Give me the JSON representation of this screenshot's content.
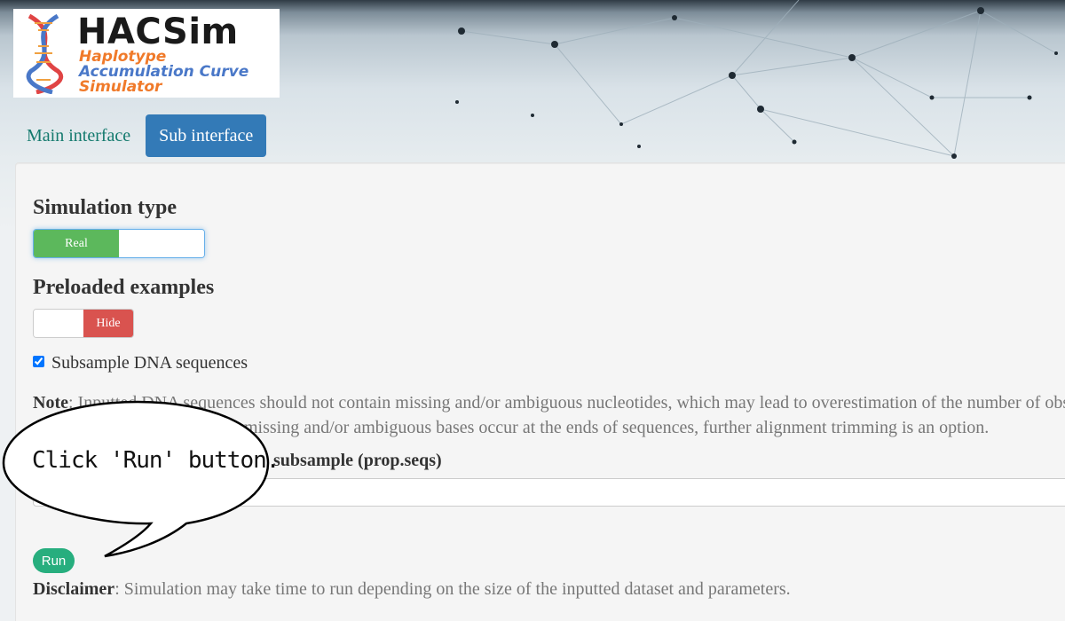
{
  "app": {
    "logo": {
      "title": "HACSim",
      "subtitle_lines": [
        "Haplotype",
        "Accumulation Curve",
        "Simulator"
      ]
    }
  },
  "tabs": [
    {
      "label": "Main interface",
      "active": false
    },
    {
      "label": "Sub interface",
      "active": true
    }
  ],
  "simulation_type": {
    "heading": "Simulation type",
    "toggle_value": "Real"
  },
  "preloaded_examples": {
    "heading": "Preloaded examples",
    "toggle_value": "Hide"
  },
  "subsample": {
    "checked": true,
    "label": "Subsample DNA sequences"
  },
  "note": {
    "label": "Note",
    "line1": ": Inputted DNA sequences should not contain missing and/or ambiguous nucleotides, which may lead to overestimation of the number of obs",
    "line2": "missing and/or ambiguous bases occur at the ends of sequences, further alignment trimming is an option."
  },
  "prop_seqs": {
    "label": "o subsample (prop.seqs)",
    "value": ""
  },
  "run_button": {
    "label": "Run"
  },
  "disclaimer": {
    "label": "Disclaimer",
    "text": ": Simulation may take time to run depending on the size of the inputted dataset and parameters."
  },
  "callout": {
    "text": "Click 'Run' button."
  },
  "colors": {
    "tab_active": "#337ab7",
    "switch_on": "#5cb85c",
    "switch_off": "#d9534f",
    "run_button": "#27ae7e"
  }
}
